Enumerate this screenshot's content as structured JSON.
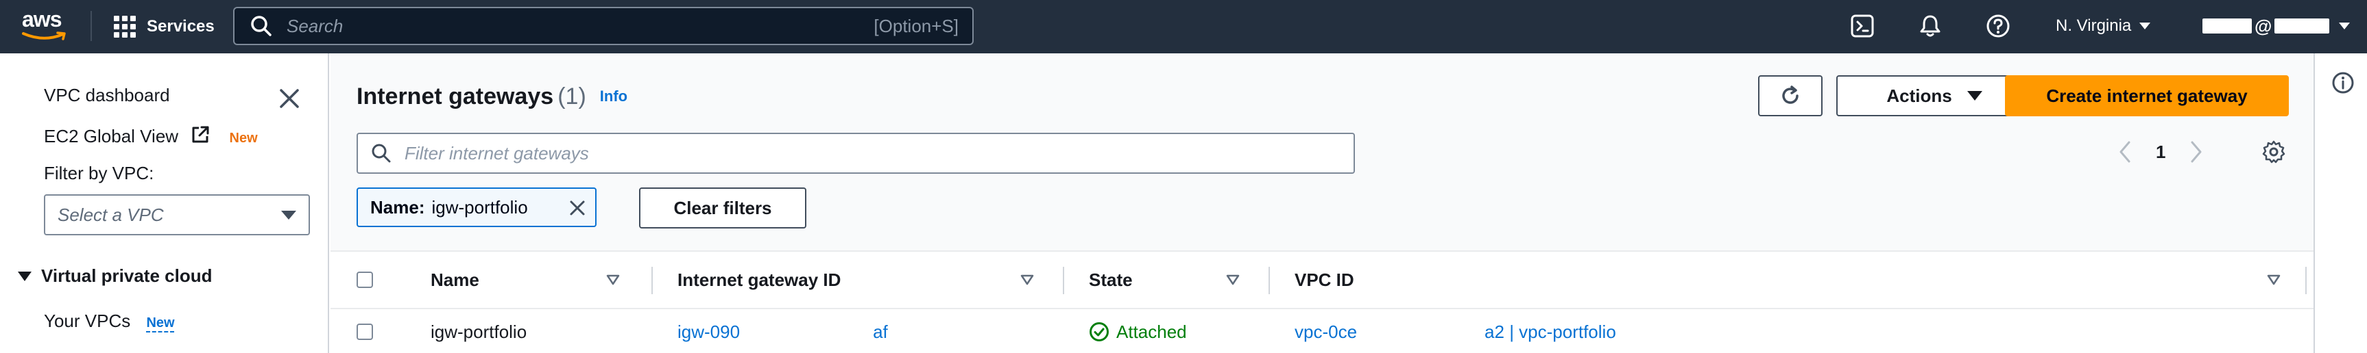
{
  "topnav": {
    "logo_text": "aws",
    "services_label": "Services",
    "search_placeholder": "Search",
    "search_shortcut": "[Option+S]",
    "region_label": "N. Virginia",
    "account_at": "@",
    "icons": [
      "cloudshell-icon",
      "notifications-bell-icon",
      "help-icon"
    ]
  },
  "sidebar": {
    "vpc_dashboard": "VPC dashboard",
    "ec2_global_view": "EC2 Global View",
    "ec2_new_badge": "New",
    "filter_label": "Filter by VPC:",
    "filter_placeholder": "Select a VPC",
    "section_title": "Virtual private cloud",
    "your_vpcs": "Your VPCs",
    "your_vpcs_badge": "New"
  },
  "main": {
    "title": "Internet gateways",
    "count": "(1)",
    "info_label": "Info",
    "actions_label": "Actions",
    "create_label": "Create internet gateway",
    "filter_placeholder": "Filter internet gateways",
    "page_number": "1",
    "token": {
      "key": "Name:",
      "value": "igw-portfolio"
    },
    "clear_filters_label": "Clear filters"
  },
  "table": {
    "columns": [
      "Name",
      "Internet gateway ID",
      "State",
      "VPC ID"
    ],
    "rows": [
      {
        "name": "igw-portfolio",
        "igw_id_start": "igw-090",
        "igw_id_end": "af",
        "state": "Attached",
        "vpc_id_start": "vpc-0ce",
        "vpc_id_end": "a2 | vpc-portfolio"
      }
    ]
  },
  "colors": {
    "nav_bg": "#232f3e",
    "primary_button": "#ff9900",
    "link": "#0972d3",
    "success": "#037f0c"
  }
}
